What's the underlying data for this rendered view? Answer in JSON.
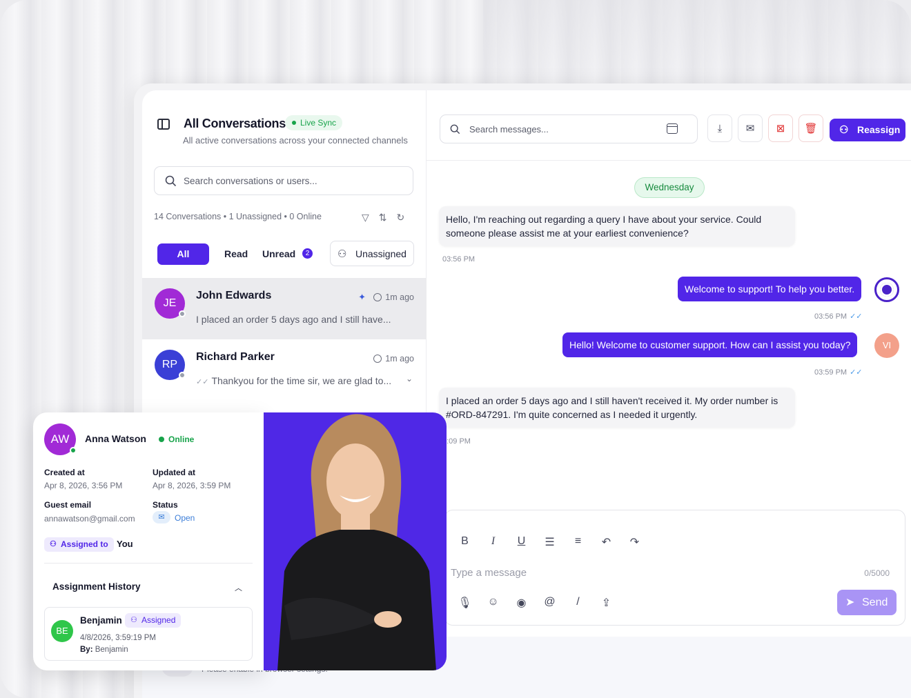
{
  "colors": {
    "accent": "#5126e8",
    "online": "#17a34a",
    "danger": "#e03131"
  },
  "left_panel": {
    "title": "All Conversations",
    "live_badge": "Live Sync",
    "subtitle": "All active conversations across your connected channels",
    "search_placeholder": "Search conversations or users...",
    "stats": "14 Conversations • 1 Unassigned • 0 Online",
    "tabs": {
      "all": "All",
      "read": "Read",
      "unread": "Unread",
      "unread_count": "2",
      "unassigned": "Unassigned"
    },
    "conversations": [
      {
        "initials": "JE",
        "name": "John Edwards",
        "time": "1m ago",
        "preview": "I placed an order 5 days ago and I still have...",
        "avatar_color": "#a12ad6"
      },
      {
        "initials": "RP",
        "name": "Richard Parker",
        "time": "1m ago",
        "preview": "Thankyou for the time sir, we are glad to...",
        "avatar_color": "#3a3fd6"
      }
    ]
  },
  "chat": {
    "search_placeholder": "Search messages...",
    "reassign_label": "Reassign",
    "day_label": "Wednesday",
    "messages": [
      {
        "text": "Hello, I'm reaching out regarding a query I have about your service. Could someone please assist me at your earliest convenience?",
        "time": "03:56 PM"
      },
      {
        "text": "Welcome to support! To help you better.",
        "time": "03:56 PM"
      },
      {
        "text": "Hello! Welcome to customer support. How can I assist you today?",
        "time": "03:59 PM",
        "avatar": "VI"
      },
      {
        "text": "I placed an order 5 days ago and I still haven't received it. My order number is #ORD-847291. I'm quite concerned as I needed it urgently.",
        "time": "4:09 PM"
      }
    ],
    "composer": {
      "placeholder": "Type a message",
      "counter": "0/5000",
      "send_label": "Send"
    },
    "notice_text": "Please enable in browser settings."
  },
  "contact_card": {
    "initials": "AW",
    "name": "Anna Watson",
    "presence": "Online",
    "created_label": "Created at",
    "created_value": "Apr 8, 2026, 3:56 PM",
    "updated_label": "Updated at",
    "updated_value": "Apr 8, 2026, 3:59 PM",
    "email_label": "Guest email",
    "email_value": "annawatson@gmail.com",
    "status_label": "Status",
    "status_value": "Open",
    "assigned_label": "Assigned to",
    "assigned_value": "You",
    "history_title": "Assignment History",
    "history": {
      "initials": "BE",
      "name": "Benjamin",
      "badge": "Assigned",
      "date": "4/8/2026, 3:59:19 PM",
      "by_label": "By:",
      "by_value": "Benjamin"
    }
  }
}
